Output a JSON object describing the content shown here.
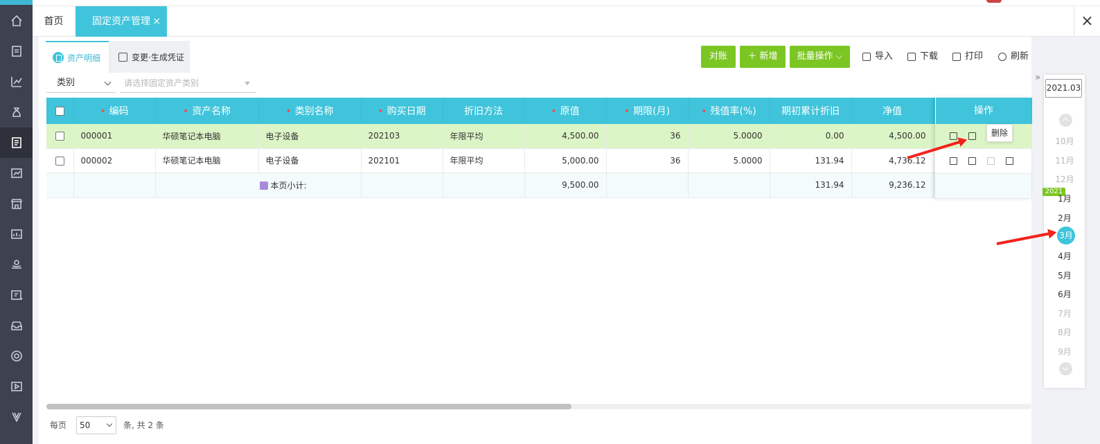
{
  "tabs": {
    "home": "首页",
    "active": "固定资产管理",
    "close": "×",
    "window_close": "×"
  },
  "subtabs": [
    "资产明细",
    "变更·生成凭证"
  ],
  "toolbar": {
    "reconcile": "对账",
    "add": "＋ 新增",
    "batch": "批量操作",
    "import": "导入",
    "download": "下载",
    "print": "打印",
    "refresh": "刷新"
  },
  "filter": {
    "category_select": "类别",
    "category_placeholder": "请选择固定资产类别"
  },
  "table": {
    "headers": [
      "编码",
      "资产名称",
      "类别名称",
      "购买日期",
      "折旧方法",
      "原值",
      "期限(月)",
      "残值率(%)",
      "期初累计折旧",
      "净值",
      "操作"
    ],
    "rows": [
      {
        "code": "000001",
        "name": "华硕笔记本电脑",
        "category": "电子设备",
        "date": "202103",
        "method": "年限平均",
        "original": "4,500.00",
        "term": "36",
        "residual": "5.0000",
        "accum": "0.00",
        "net": "4,500.00"
      },
      {
        "code": "000002",
        "name": "华硕笔记本电脑",
        "category": "电子设备",
        "date": "202101",
        "method": "年限平均",
        "original": "5,000.00",
        "term": "36",
        "residual": "5.0000",
        "accum": "131.94",
        "net": "4,736.12"
      }
    ],
    "subtotal": {
      "label": "本页小计:",
      "original": "9,500.00",
      "accum": "131.94",
      "net": "9,236.12"
    }
  },
  "tooltip": "删除",
  "pager": {
    "per_page": "每页",
    "size": "50",
    "summary": "条, 共 2 条"
  },
  "timeline": {
    "year": "2021.03",
    "year_badge": "2021",
    "collapse": "»",
    "months": [
      "10月",
      "11月",
      "12月",
      "1月",
      "2月",
      "3月",
      "4月",
      "5月",
      "6月",
      "7月",
      "8月",
      "9月"
    ]
  }
}
